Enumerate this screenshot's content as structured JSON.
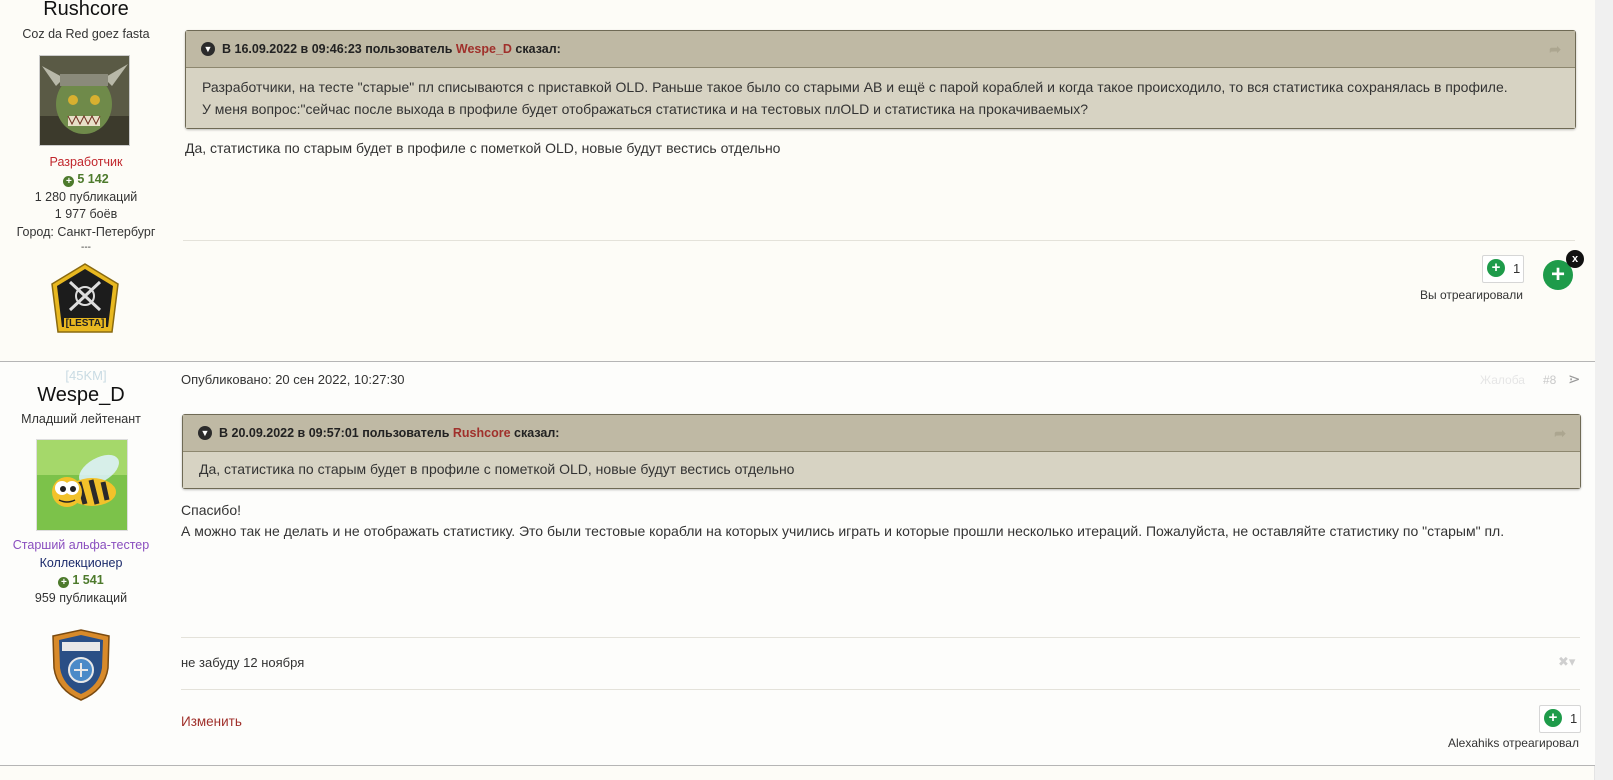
{
  "post1": {
    "author": {
      "name": "Rushcore",
      "title": "Coz da Red goez fasta",
      "group": "Разработчик",
      "reputation": "5 142",
      "posts": "1 280 публикаций",
      "battles": "1 977 боёв",
      "city": "Город: Санкт-Петербург",
      "separator": "---",
      "badge_text": "[LESTA]"
    },
    "quote": {
      "prefix": "В 16.09.2022 в 09:46:23 пользователь ",
      "user": "Wespe_D",
      "suffix": " сказал:",
      "line1": "Разработчики, на тесте \"старые\" пл списываются с приставкой OLD. Раньше такое было со старыми АВ и ещё с парой кораблей и когда такое происходило, то вся статистика сохранялась в профиле.",
      "line2": "У меня вопрос:\"сейчас после выхода в профиле будет отображаться статистика и на тестовых плOLD и статистика на прокачиваемых?"
    },
    "body": "Да, статистика по старым будет в профиле с пометкой OLD, новые будут вестись отдельно",
    "reaction_count": "1",
    "reacted_text": "Вы отреагировали",
    "close_label": "x"
  },
  "post2": {
    "author": {
      "clan": "[45KM]",
      "name": "Wespe_D",
      "rank": "Младший лейтенант",
      "group": "Старший альфа-тестер",
      "badge": "Коллекционер",
      "reputation": "1 541",
      "posts": "959 публикаций"
    },
    "published": "Опубликовано: 20 сен 2022, 10:27:30",
    "report": "Жалоба",
    "number": "#8",
    "quote": {
      "prefix": "В 20.09.2022 в 09:57:01 пользователь ",
      "user": "Rushcore",
      "suffix": " сказал:",
      "line1": "Да, статистика по старым будет в профиле с пометкой OLD, новые будут вестись отдельно"
    },
    "body_line1": "Спасибо!",
    "body_line2": " А можно так не делать и не отображать статистику. Это были тестовые корабли на которых учились играть и которые прошли несколько итераций. Пожалуйста, не оставляйте статистику по \"старым\" пл.",
    "signature": "не забуду 12 ноября",
    "edit_label": "Изменить",
    "reaction_count": "1",
    "reacted_text": "Alexahiks отреагировал"
  },
  "colors": {
    "quote_bg": "#d7d3c3",
    "quote_head_bg": "#bfb9a4",
    "link_red": "#a0302b",
    "reaction_green": "#1e9b4a",
    "developer_red": "#c1272d",
    "alpha_purple": "#8a4fbf"
  },
  "icons": [
    "chevron-down-icon",
    "share-icon",
    "plus-icon",
    "close-icon"
  ]
}
